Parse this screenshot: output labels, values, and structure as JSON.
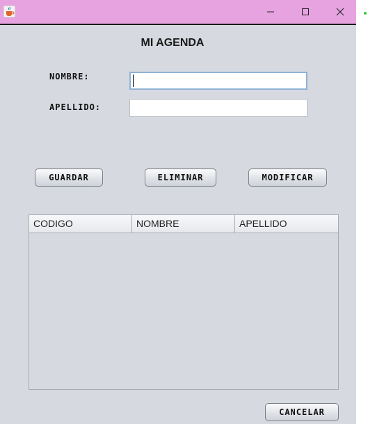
{
  "window": {
    "title": "",
    "icons": {
      "app": "java-cup-icon",
      "minimize": "minimize-icon",
      "maximize": "maximize-icon",
      "close": "close-icon"
    },
    "colors": {
      "titlebar": "#e6a3e0",
      "body": "#d6d9e0"
    }
  },
  "form": {
    "heading": "MI AGENDA",
    "nombre_label": "NOMBRE:",
    "nombre_value": "",
    "apellido_label": "APELLIDO:",
    "apellido_value": ""
  },
  "buttons": {
    "guardar": "GUARDAR",
    "eliminar": "ELIMINAR",
    "modificar": "MODIFICAR",
    "cancelar": "CANCELAR"
  },
  "table": {
    "columns": [
      "CODIGO",
      "NOMBRE",
      "APELLIDO"
    ],
    "rows": []
  }
}
